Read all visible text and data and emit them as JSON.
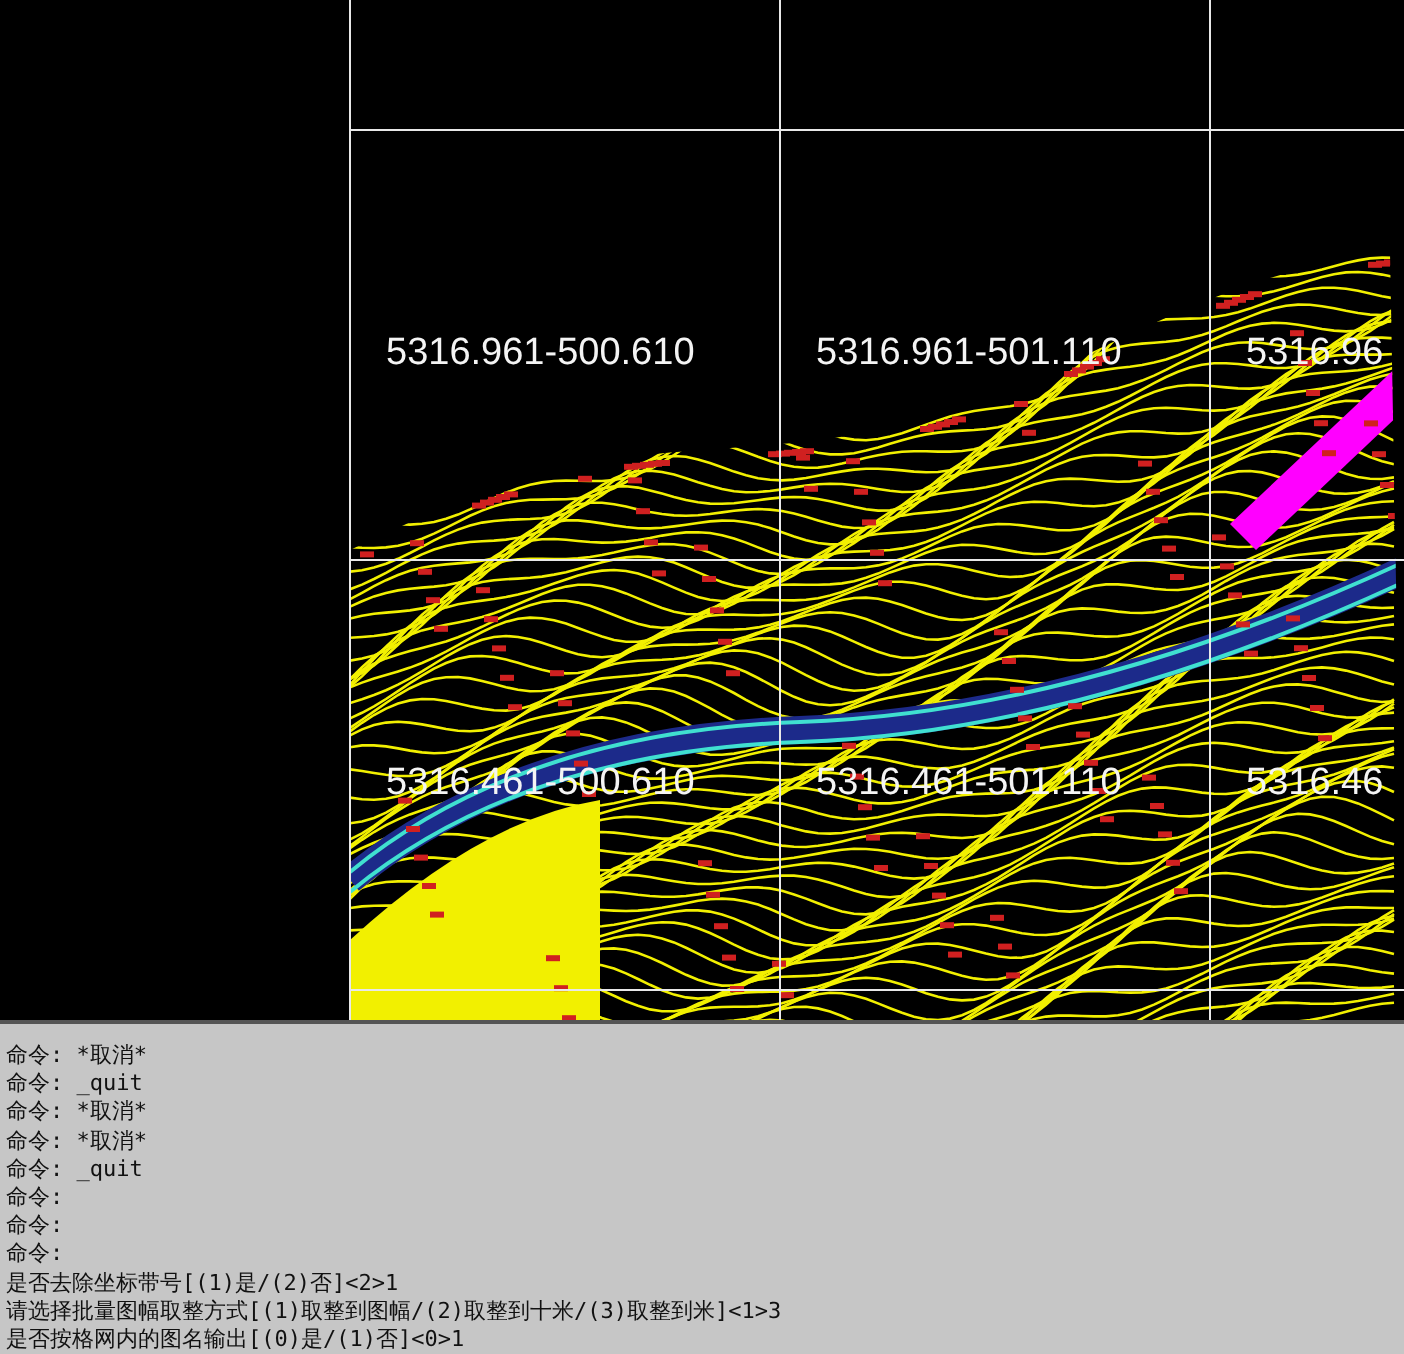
{
  "drawing": {
    "sheet_labels": [
      "5316.961-500.610",
      "5316.961-501.110",
      "5316.96",
      "5316.461-500.610",
      "5316.461-501.110",
      "5316.46"
    ]
  },
  "command_line": {
    "lines": [
      "命令: *取消*",
      "命令: _quit",
      "命令: *取消*",
      "命令: *取消*",
      "命令: _quit",
      "命令:",
      "命令:",
      "命令:",
      "是否去除坐标带号[(1)是/(2)否]<2>1",
      "请选择批量图幅取整方式[(1)取整到图幅/(2)取整到十米/(3)取整到米]<1>3",
      "是否按格网内的图名输出[(0)是/(1)否]<0>1"
    ]
  }
}
